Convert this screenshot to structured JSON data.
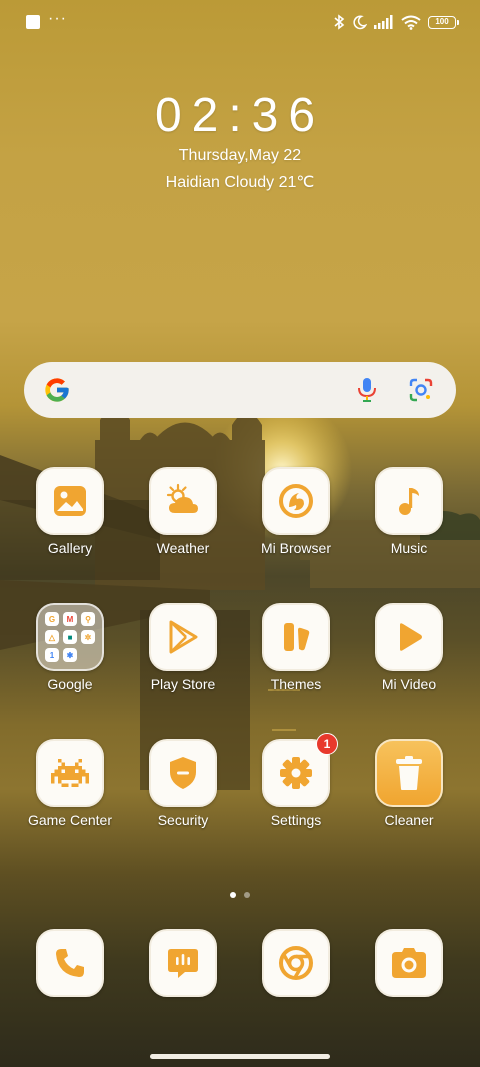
{
  "status_bar": {
    "notification_icons": [
      "notification-square-icon",
      "more-notifications-dots-icon"
    ],
    "system_icons": [
      "bluetooth-icon",
      "do-not-disturb-moon-icon",
      "cellular-signal-icon",
      "wifi-icon"
    ],
    "battery_level": "100"
  },
  "clock_widget": {
    "time": "02:36",
    "date": "Thursday,May 22",
    "weather": "Haidian Cloudy 21℃"
  },
  "search_bar": {
    "icons": [
      "google-g-logo",
      "voice-search-mic-icon",
      "google-lens-icon"
    ]
  },
  "apps": [
    {
      "label": "Gallery",
      "icon": "gallery-icon"
    },
    {
      "label": "Weather",
      "icon": "weather-icon"
    },
    {
      "label": "Mi Browser",
      "icon": "mi-browser-icon"
    },
    {
      "label": "Music",
      "icon": "music-note-icon"
    },
    {
      "label": "Google",
      "icon": "google-folder-icon"
    },
    {
      "label": "Play Store",
      "icon": "play-store-icon"
    },
    {
      "label": "Themes",
      "icon": "themes-icon"
    },
    {
      "label": "Mi Video",
      "icon": "mi-video-play-icon"
    },
    {
      "label": "Game Center",
      "icon": "game-center-invader-icon"
    },
    {
      "label": "Security",
      "icon": "security-shield-icon"
    },
    {
      "label": "Settings",
      "icon": "settings-gear-icon",
      "badge": "1"
    },
    {
      "label": "Cleaner",
      "icon": "cleaner-trash-icon"
    }
  ],
  "google_folder_apps": [
    "google-search-icon",
    "gmail-icon",
    "maps-icon",
    "drive-icon",
    "meet-icon",
    "photos-icon",
    "google-one-icon",
    "assistant-icon",
    "extra-app-icon"
  ],
  "dock": [
    {
      "icon": "phone-icon"
    },
    {
      "icon": "messages-icon"
    },
    {
      "icon": "chrome-icon"
    },
    {
      "icon": "camera-icon"
    }
  ],
  "pager": {
    "pages": 2,
    "current": 1
  },
  "colors": {
    "accent": "#f0a531",
    "icon_background": "#fdfbf6",
    "badge": "#e8392c",
    "search_background": "#f3f1ec"
  }
}
